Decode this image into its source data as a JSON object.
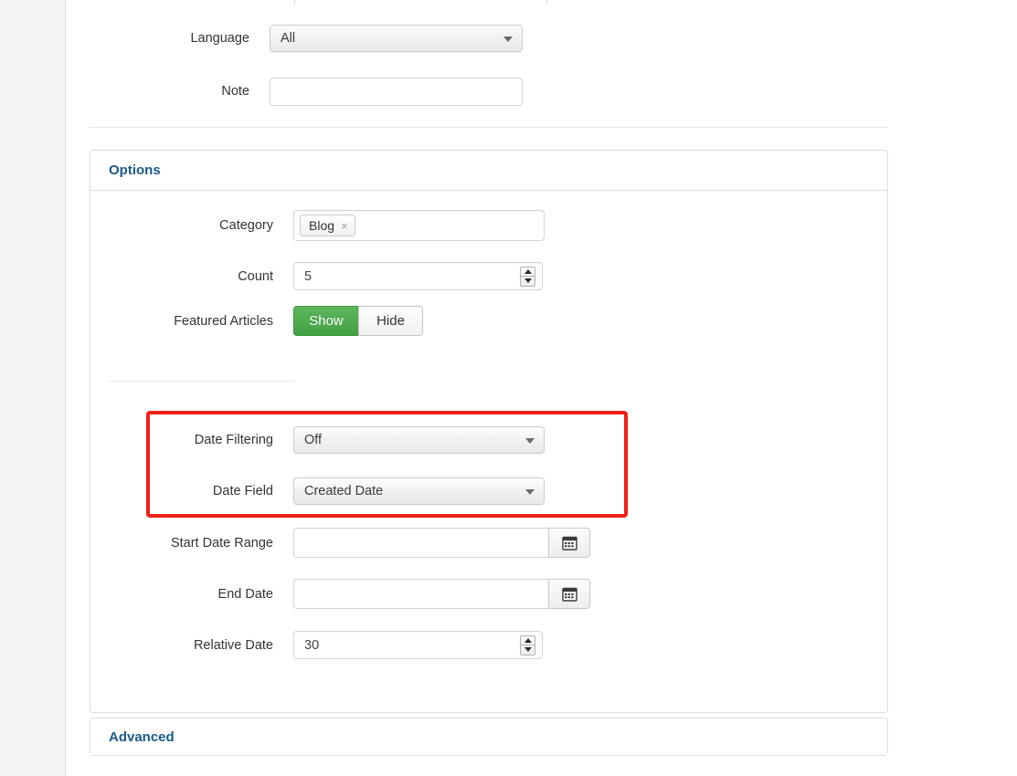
{
  "layout": {
    "accent_blue": "#1b5a87",
    "highlight_red": "#ef2117",
    "toggle_green": "#42a142",
    "page_bg": "#ffffff",
    "gutter_bg": "#f4f4f4"
  },
  "top_fields": [
    {
      "label": "Language",
      "type": "select",
      "value": "All",
      "name": "language"
    },
    {
      "label": "Note",
      "type": "text",
      "value": "",
      "placeholder": "",
      "name": "note"
    }
  ],
  "options_panel": {
    "title": "Options",
    "fields": {
      "category": {
        "label": "Category",
        "tags": [
          {
            "text": "Blog",
            "remove_icon": "×"
          }
        ]
      },
      "count": {
        "label": "Count",
        "value": "5"
      },
      "featured_articles": {
        "label": "Featured Articles",
        "options": [
          "Show",
          "Hide"
        ],
        "selected": "Show"
      },
      "date_filtering": {
        "label": "Date Filtering",
        "value": "Off"
      },
      "date_field": {
        "label": "Date Field",
        "value": "Created Date"
      },
      "start_date_range": {
        "label": "Start Date Range",
        "value": "",
        "placeholder": "",
        "button_icon": "calendar-icon"
      },
      "end_date": {
        "label": "End Date",
        "value": "",
        "placeholder": "",
        "button_icon": "calendar-icon"
      },
      "relative_date": {
        "label": "Relative Date",
        "value": "30"
      }
    }
  },
  "advanced_panel": {
    "title": "Advanced"
  },
  "annotation": {
    "type": "red-rectangle-highlight",
    "targets": [
      "Date Filtering",
      "Date Field"
    ]
  }
}
